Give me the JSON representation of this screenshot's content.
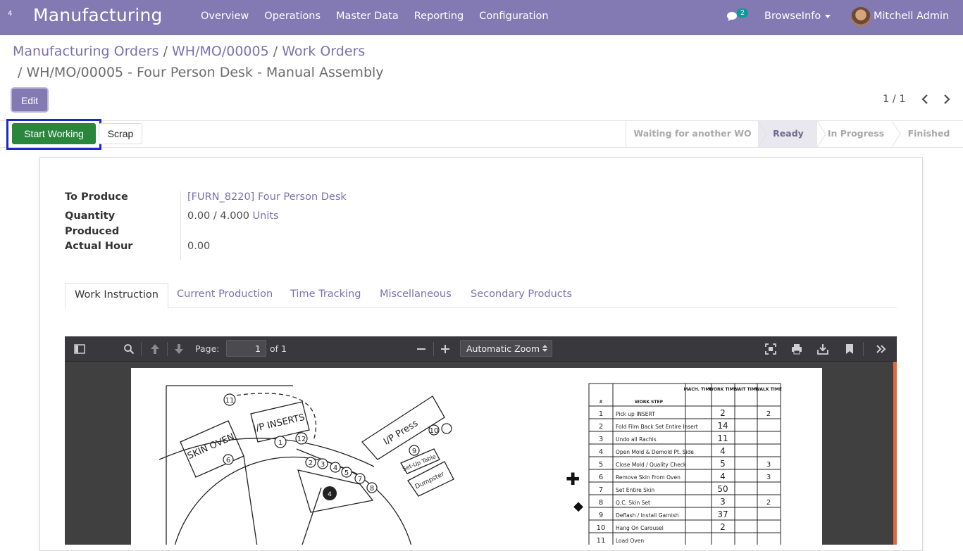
{
  "navbar": {
    "apps_count": "4",
    "brand": "Manufacturing",
    "menu": [
      "Overview",
      "Operations",
      "Master Data",
      "Reporting",
      "Configuration"
    ],
    "chat_count": "2",
    "company": "BrowseInfo",
    "user": "Mitchell Admin"
  },
  "breadcrumb": {
    "items": [
      "Manufacturing Orders",
      "WH/MO/00005",
      "Work Orders"
    ],
    "current": "WH/MO/00005 - Four Person Desk - Manual Assembly"
  },
  "control": {
    "edit_label": "Edit",
    "pager": "1 / 1"
  },
  "statusbar": {
    "start_label": "Start Working",
    "scrap_label": "Scrap",
    "stages": [
      "Waiting for another WO",
      "Ready",
      "In Progress",
      "Finished"
    ],
    "active_stage": "Ready"
  },
  "form": {
    "to_produce_label": "To Produce",
    "to_produce_value": "[FURN_8220] Four Person Desk",
    "qty_label_1": "Quantity",
    "qty_label_2": "Produced",
    "qty_value": "0.00",
    "qty_sep": "/",
    "qty_total": "4.000",
    "qty_uom": "Units",
    "hour_label": "Actual Hour",
    "hour_value": "0.00"
  },
  "tabs": [
    "Work Instruction",
    "Current Production",
    "Time Tracking",
    "Miscellaneous",
    "Secondary Products"
  ],
  "pdf": {
    "page_label": "Page:",
    "page_value": "1",
    "page_total": "of 1",
    "zoom": "Automatic Zoom"
  },
  "drawing": {
    "callout_top": "11",
    "oven": "SKIN OVEN",
    "inserts": "I/P INSERTS",
    "press": "I/P Press",
    "callouts": [
      "1",
      "12",
      "2",
      "3",
      "4",
      "5",
      "7",
      "8",
      "6",
      "9",
      "10"
    ],
    "table_label": "Set-Up Table",
    "dumpster": "Dumpster",
    "hub": "4"
  },
  "worksheet": {
    "headers": [
      "#",
      "WORK STEP",
      "MACH. TIME",
      "WORK TIME",
      "WAIT TIME",
      "WALK TIME"
    ],
    "rows": [
      {
        "n": "1",
        "step": "Pick up INSERT",
        "work": "2",
        "walk": "2"
      },
      {
        "n": "2",
        "step": "Fold Film Back Set Entire Insert",
        "work": "14",
        "walk": ""
      },
      {
        "n": "3",
        "step": "Undo all Rachis",
        "work": "11",
        "walk": ""
      },
      {
        "n": "4",
        "step": "Open Mold & Demold Pt. Side",
        "work": "4",
        "walk": ""
      },
      {
        "n": "5",
        "step": "Close Mold / Quality Check",
        "work": "5",
        "walk": "3"
      },
      {
        "n": "6",
        "step": "Remove Skin From Oven",
        "work": "4",
        "walk": "3"
      },
      {
        "n": "7",
        "step": "Set Entire Skin",
        "work": "50",
        "walk": ""
      },
      {
        "n": "8",
        "step": "Q.C. Skin Set",
        "work": "3",
        "walk": "2"
      },
      {
        "n": "9",
        "step": "Deflash / Install Garnish",
        "work": "37",
        "walk": ""
      },
      {
        "n": "10",
        "step": "Hang On Carousel",
        "work": "2",
        "walk": ""
      },
      {
        "n": "11",
        "step": "Load Oven",
        "work": "",
        "walk": ""
      }
    ]
  }
}
